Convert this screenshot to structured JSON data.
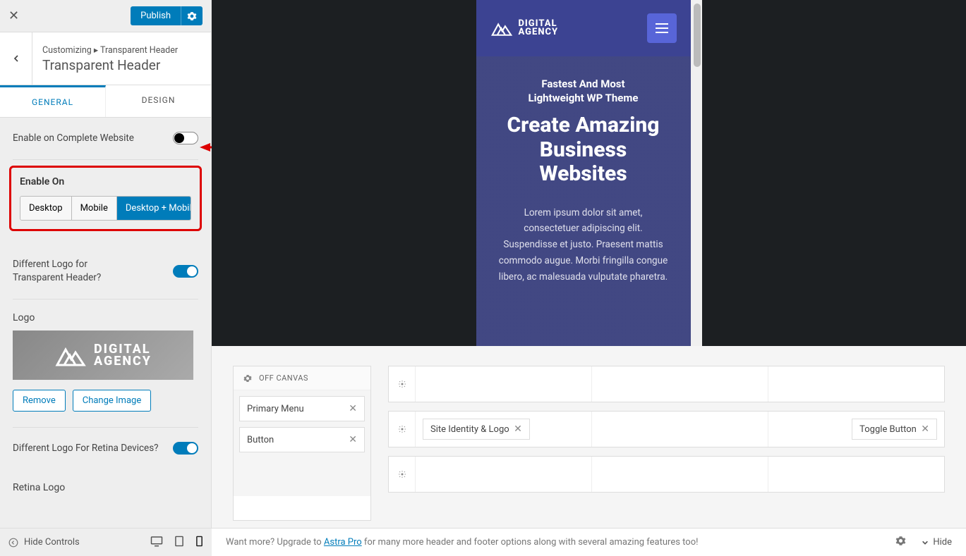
{
  "sidebar": {
    "publish_label": "Publish",
    "breadcrumb_root": "Customizing",
    "breadcrumb_sep": "▸",
    "breadcrumb_leaf": "Transparent Header",
    "title": "Transparent Header",
    "tabs": {
      "general": "GENERAL",
      "design": "DESIGN"
    },
    "controls": {
      "enable_complete": "Enable on Complete Website",
      "enable_on_title": "Enable On",
      "enable_on_options": [
        "Desktop",
        "Mobile",
        "Desktop + Mobile"
      ],
      "diff_logo": "Different Logo for Transparent Header?",
      "logo_label": "Logo",
      "logo_text1": "DIGITAL",
      "logo_text2": "AGENCY",
      "remove": "Remove",
      "change_image": "Change Image",
      "diff_retina": "Different Logo For Retina Devices?",
      "retina_label": "Retina Logo"
    },
    "footer": {
      "hide_controls": "Hide Controls"
    }
  },
  "preview": {
    "logo_l1": "DIGITAL",
    "logo_l2": "AGENCY",
    "sub1": "Fastest And Most",
    "sub2": "Lightweight WP Theme",
    "title1": "Create Amazing",
    "title2": "Business",
    "title3": "Websites",
    "desc": "Lorem ipsum dolor sit amet, consectetuer adipiscing elit. Suspendisse et justo. Praesent mattis commodo augue. Morbi fringilla congue libero, ac malesuada vulputate pharetra."
  },
  "builder": {
    "offcanvas_title": "OFF CANVAS",
    "widgets": {
      "primary_menu": "Primary Menu",
      "button": "Button",
      "site_identity": "Site Identity & Logo",
      "toggle_button": "Toggle Button"
    }
  },
  "bottombar": {
    "text_before": "Want more? Upgrade to ",
    "link": "Astra Pro",
    "text_after": " for many more header and footer options along with several amazing features too!",
    "hide": "Hide"
  }
}
